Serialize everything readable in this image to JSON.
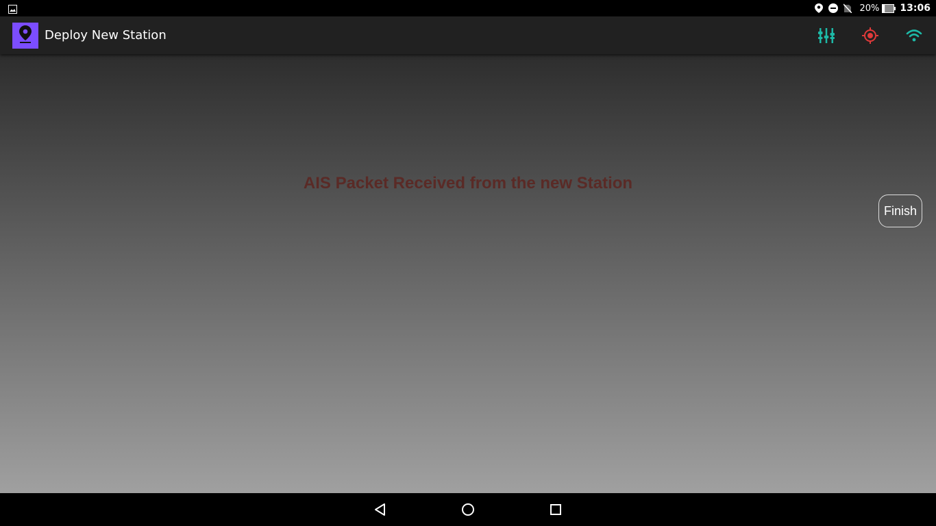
{
  "status_bar": {
    "left_icon": "image-icon",
    "icons": [
      "location-icon",
      "do-not-disturb-icon",
      "no-sim-icon"
    ],
    "battery_percent": "20%",
    "battery_level": 0.2,
    "time": "13:06"
  },
  "app_bar": {
    "logo_icon": "map-pin-icon",
    "title": "Deploy New Station",
    "actions": [
      {
        "name": "equalizer-icon",
        "color": "#1db8a6"
      },
      {
        "name": "crosshair-icon",
        "color": "#e03a3a"
      },
      {
        "name": "wifi-icon",
        "color": "#1db8a6"
      }
    ]
  },
  "main": {
    "message": "AIS Packet Received from the new Station",
    "finish_label": "Finish"
  },
  "nav_bar": {
    "buttons": [
      "back-icon",
      "home-icon",
      "recents-icon"
    ]
  },
  "colors": {
    "accent": "#7c4dff",
    "teal": "#1db8a6",
    "red": "#e03a3a",
    "message_text": "#5a2a26"
  }
}
